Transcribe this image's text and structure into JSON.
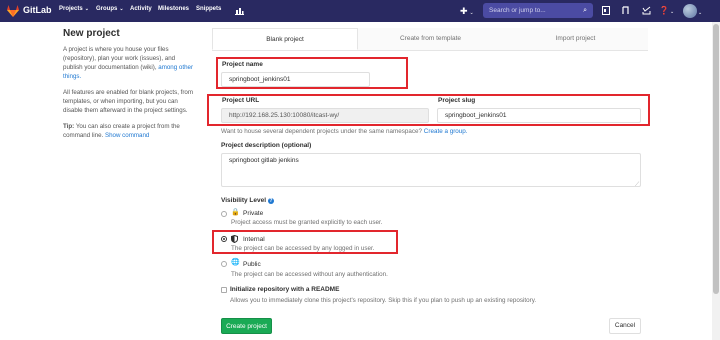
{
  "topbar": {
    "brand": "GitLab",
    "nav": [
      {
        "label": "Projects",
        "caret": "⌄"
      },
      {
        "label": "Groups",
        "caret": "⌄"
      },
      {
        "label": "Activity",
        "caret": ""
      },
      {
        "label": "Milestones",
        "caret": ""
      },
      {
        "label": "Snippets",
        "caret": ""
      }
    ],
    "chart_icon": "chart-icon",
    "plus_icon": "plus-icon",
    "search_placeholder": "Search or jump to...",
    "right_icons": [
      "issues-icon",
      "merge-request-icon",
      "todo-icon",
      "help-icon"
    ],
    "colors": {
      "topbar": "#292961",
      "accent": "#1f78d1",
      "primary_button": "#1aaa55",
      "highlight": "#e2262d"
    }
  },
  "sidebar": {
    "title": "New project",
    "p1_text": "A project is where you house your files (repository), plan your work (issues), and publish your documentation (wiki), ",
    "p1_link": "among other things.",
    "p2_text": "All features are enabled for blank projects, from templates, or when importing, but you can disable them afterward in the project settings.",
    "tip_label": "Tip:",
    "tip_text": " You can also create a project from the command line. ",
    "tip_link": "Show command"
  },
  "tabs": [
    {
      "label": "Blank project",
      "active": true
    },
    {
      "label": "Create from template",
      "active": false
    },
    {
      "label": "Import project",
      "active": false
    }
  ],
  "form": {
    "project_name_label": "Project name",
    "project_name_value": "springboot_jenkins01",
    "project_url_label": "Project URL",
    "project_url_value": "http://192.168.25.130:10080/itcast-wy/",
    "project_slug_label": "Project slug",
    "project_slug_value": "springboot_jenkins01",
    "namespace_help": "Want to house several dependent projects under the same namespace? ",
    "namespace_link": "Create a group.",
    "description_label": "Project description (optional)",
    "description_value": "springboot gitlab jenkins",
    "visibility_label": "Visibility Level",
    "visibility_help_icon": "question-icon",
    "visibility_options": [
      {
        "name": "Private",
        "desc": "Project access must be granted explicitly to each user.",
        "icon": "lock-icon",
        "checked": false
      },
      {
        "name": "Internal",
        "desc": "The project can be accessed by any logged in user.",
        "icon": "shield-icon",
        "checked": true
      },
      {
        "name": "Public",
        "desc": "The project can be accessed without any authentication.",
        "icon": "globe-icon",
        "checked": false
      }
    ],
    "init_readme_label": "Initialize repository with a README",
    "init_readme_desc": "Allows you to immediately clone this project's repository. Skip this if you plan to push up an existing repository.",
    "init_readme_checked": false,
    "create_button": "Create project",
    "cancel_button": "Cancel"
  }
}
